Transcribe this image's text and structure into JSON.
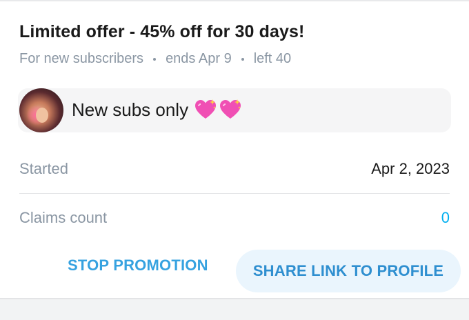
{
  "promo": {
    "title": "Limited offer - 45% off for 30 days!",
    "audience": "For new subscribers",
    "ends": "ends Apr 9",
    "left": "left 40"
  },
  "message": {
    "text": "New subs only",
    "emoji": "💖✨ 💖✨",
    "avatar_icon": "creator-avatar"
  },
  "details": {
    "started_label": "Started",
    "started_value": "Apr 2, 2023",
    "claims_label": "Claims count",
    "claims_value": "0"
  },
  "actions": {
    "stop_label": "STOP PROMOTION",
    "share_label": "SHARE LINK TO PROFILE"
  },
  "colors": {
    "accent": "#00aff0",
    "muted": "#8a96a3",
    "button_bg": "#eaf5fd"
  }
}
